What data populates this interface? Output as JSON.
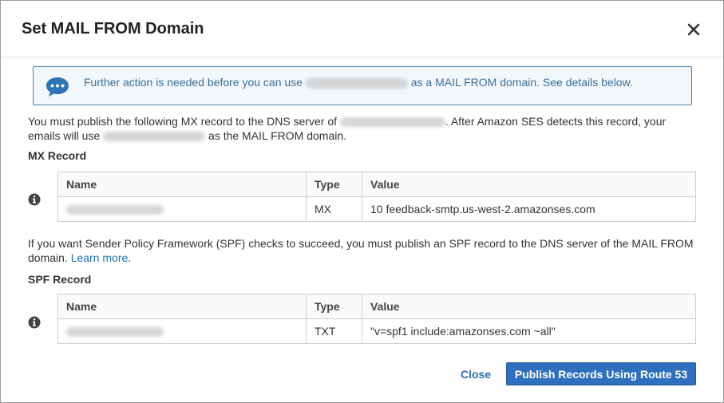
{
  "dialog": {
    "title": "Set MAIL FROM Domain",
    "close_icon": "close-icon"
  },
  "notice": {
    "icon": "chat-bubble-icon",
    "text_before": "Further action is needed before you can use",
    "text_after": "as a MAIL FROM domain. See details below."
  },
  "mx_intro": {
    "part1": "You must publish the following MX record to the DNS server of",
    "part2": ". After Amazon SES detects this record, your",
    "part3": "emails will use",
    "part4": "as the MAIL FROM domain."
  },
  "mx": {
    "section_title": "MX Record",
    "columns": [
      "Name",
      "Type",
      "Value"
    ],
    "row": {
      "type": "MX",
      "value": "10 feedback-smtp.us-west-2.amazonses.com"
    }
  },
  "spf_intro": {
    "text": "If you want Sender Policy Framework (SPF) checks to succeed, you must publish an SPF record to the DNS server of the MAIL FROM",
    "text2": "domain.",
    "link": "Learn more",
    "after_link": "."
  },
  "spf": {
    "section_title": "SPF Record",
    "columns": [
      "Name",
      "Type",
      "Value"
    ],
    "row": {
      "type": "TXT",
      "value": "\"v=spf1 include:amazonses.com ~all\""
    }
  },
  "footer": {
    "close_label": "Close",
    "primary_label": "Publish Records Using Route 53"
  },
  "colors": {
    "accent": "#2f70be",
    "notice_border": "#4f7ea3",
    "notice_bg": "#f1f7fb",
    "notice_text": "#3c6e99"
  }
}
